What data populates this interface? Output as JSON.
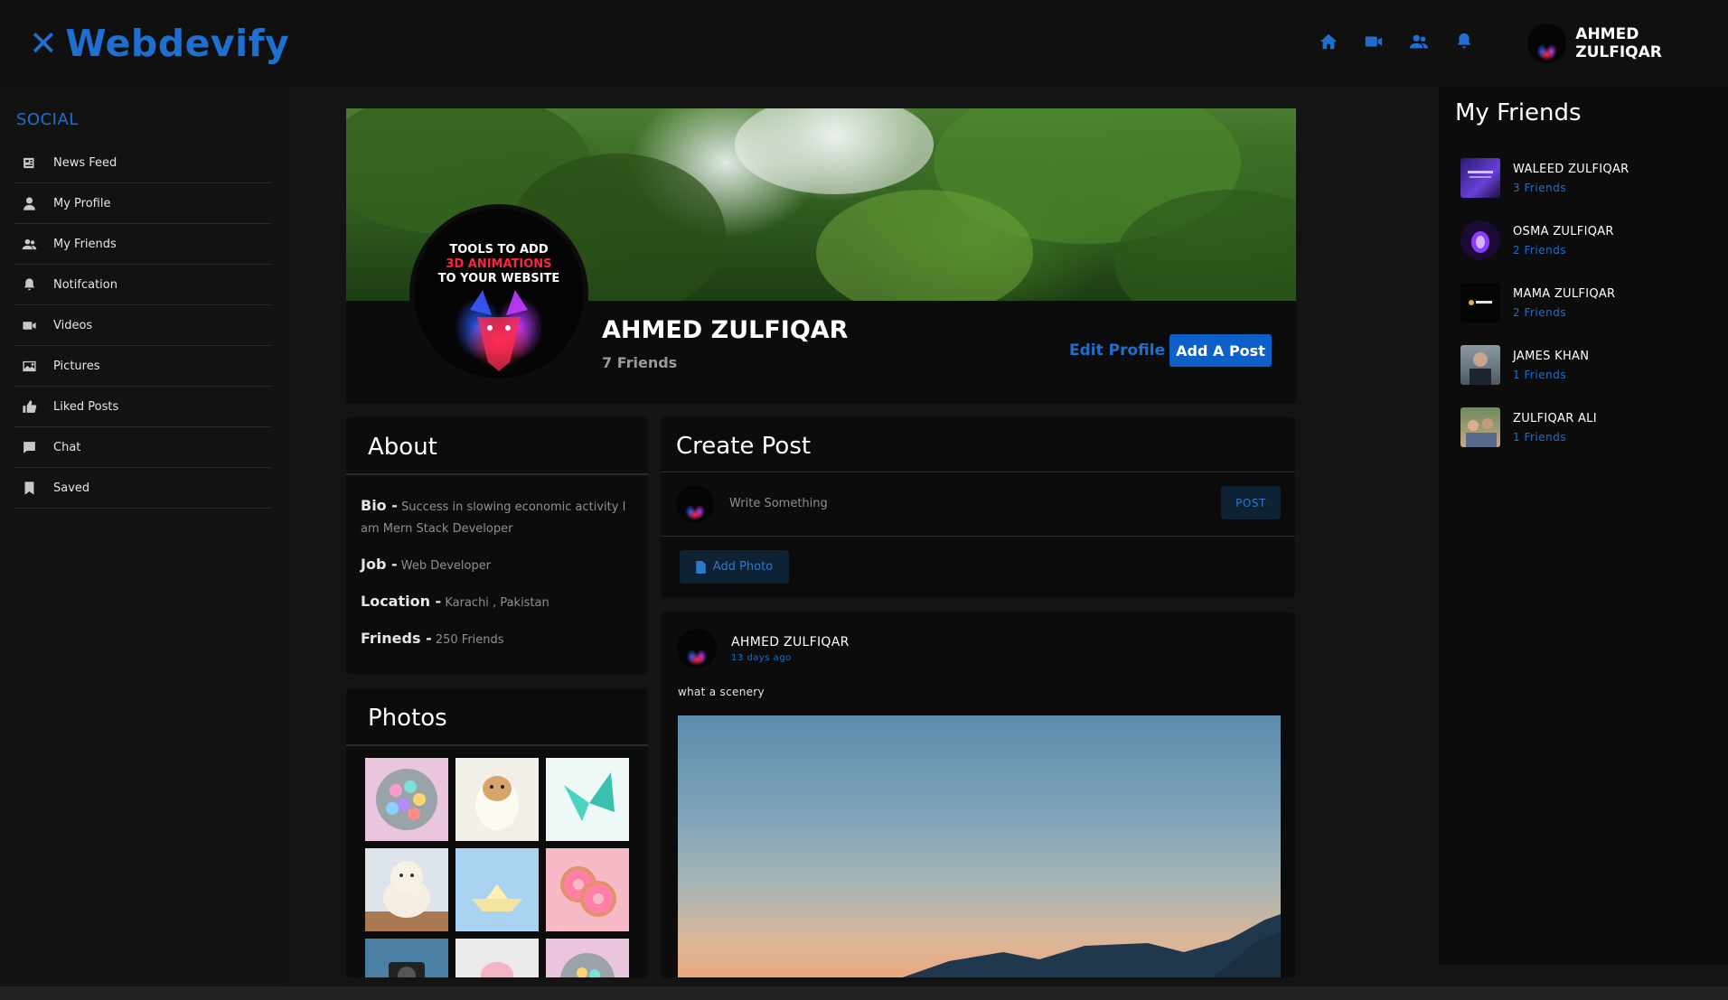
{
  "brand": {
    "logo_text": "Webdevify",
    "logo_mark": "✕"
  },
  "topnav": {
    "icons": [
      "home-icon",
      "video-icon",
      "friends-icon",
      "bell-icon"
    ],
    "user_name": "AHMED ZULFIQAR"
  },
  "sidebar": {
    "section_title": "SOCIAL",
    "items": [
      {
        "label": "News Feed",
        "icon": "newspaper-icon"
      },
      {
        "label": "My Profile",
        "icon": "user-icon"
      },
      {
        "label": "My Friends",
        "icon": "friends-icon"
      },
      {
        "label": "Notifcation",
        "icon": "bell-icon"
      },
      {
        "label": "Videos",
        "icon": "video-icon"
      },
      {
        "label": "Pictures",
        "icon": "image-icon"
      },
      {
        "label": "Liked Posts",
        "icon": "thumbs-up-icon"
      },
      {
        "label": "Chat",
        "icon": "chat-icon"
      },
      {
        "label": "Saved",
        "icon": "bookmark-icon"
      }
    ]
  },
  "profile": {
    "name": "AHMED ZULFIQAR",
    "friends": "7 Friends",
    "edit_label": "Edit Profile",
    "add_post_label": "Add A Post",
    "avatar_art": {
      "line1": "TOOLS TO ADD",
      "line2": "3D ANIMATIONS",
      "line3": "TO YOUR WEBSITE"
    }
  },
  "about": {
    "title": "About",
    "bio_label": "Bio -",
    "bio_value": "Success in slowing economic activity I am Mern Stack Developer",
    "job_label": "Job -",
    "job_value": "Web Developer",
    "location_label": "Location -",
    "location_value": "Karachi , Pakistan",
    "friends_label": "Frineds -",
    "friends_value": "250 Friends"
  },
  "photos": {
    "title": "Photos"
  },
  "create_post": {
    "title": "Create Post",
    "placeholder": "Write Something",
    "post_label": "POST",
    "add_photo_label": "Add Photo"
  },
  "post": {
    "author": "AHMED ZULFIQAR",
    "time": "13 days ago",
    "text": "what a scenery"
  },
  "friends_panel": {
    "title": "My Friends",
    "friends": [
      {
        "name": "WALEED ZULFIQAR",
        "count": "3 Friends"
      },
      {
        "name": "OSMA ZULFIQAR",
        "count": "2 Friends"
      },
      {
        "name": "MAMA ZULFIQAR",
        "count": "2 Friends"
      },
      {
        "name": "JAMES KHAN",
        "count": "1 Friends"
      },
      {
        "name": "ZULFIQAR ALI",
        "count": "1 Friends"
      }
    ]
  },
  "colors": {
    "accent": "#1f6fd0",
    "background": "#141414",
    "card": "#0c0c0c"
  }
}
